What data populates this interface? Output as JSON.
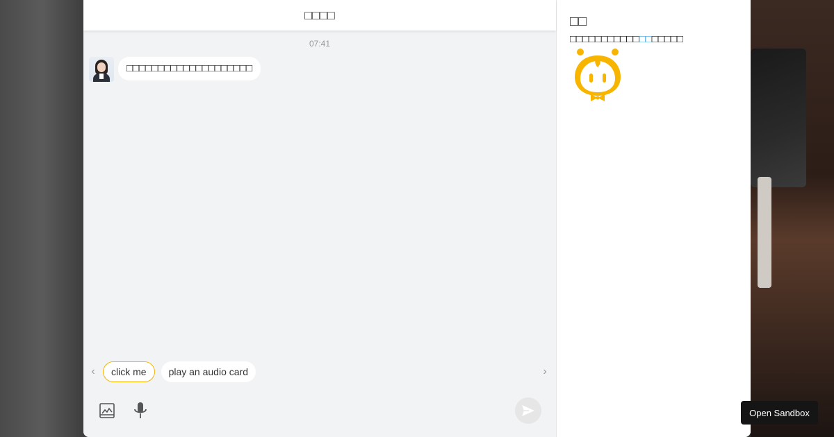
{
  "chat": {
    "title": "□□□□",
    "timestamp": "07:41",
    "messages": [
      {
        "sender": "bot",
        "avatar": "woman-avatar",
        "text": "□□□□□□□□□□□□□□□□□□□□"
      }
    ],
    "quick_replies": [
      {
        "label": "click me",
        "highlighted": true
      },
      {
        "label": "play an audio card",
        "highlighted": false
      }
    ],
    "composer": {
      "tools": [
        "image-icon",
        "microphone-icon"
      ],
      "send_icon": "send-icon"
    }
  },
  "side_panel": {
    "title": "□□",
    "text_before": "□□□□□□□□□□□",
    "text_link": "□□",
    "text_after": "□□□□□",
    "mascot": "robot-mascot-icon"
  },
  "sandbox": {
    "label": "Open Sandbox"
  },
  "colors": {
    "accent": "#f7b500",
    "link": "#3aa3e3",
    "chat_bg": "#f2f3f5"
  }
}
